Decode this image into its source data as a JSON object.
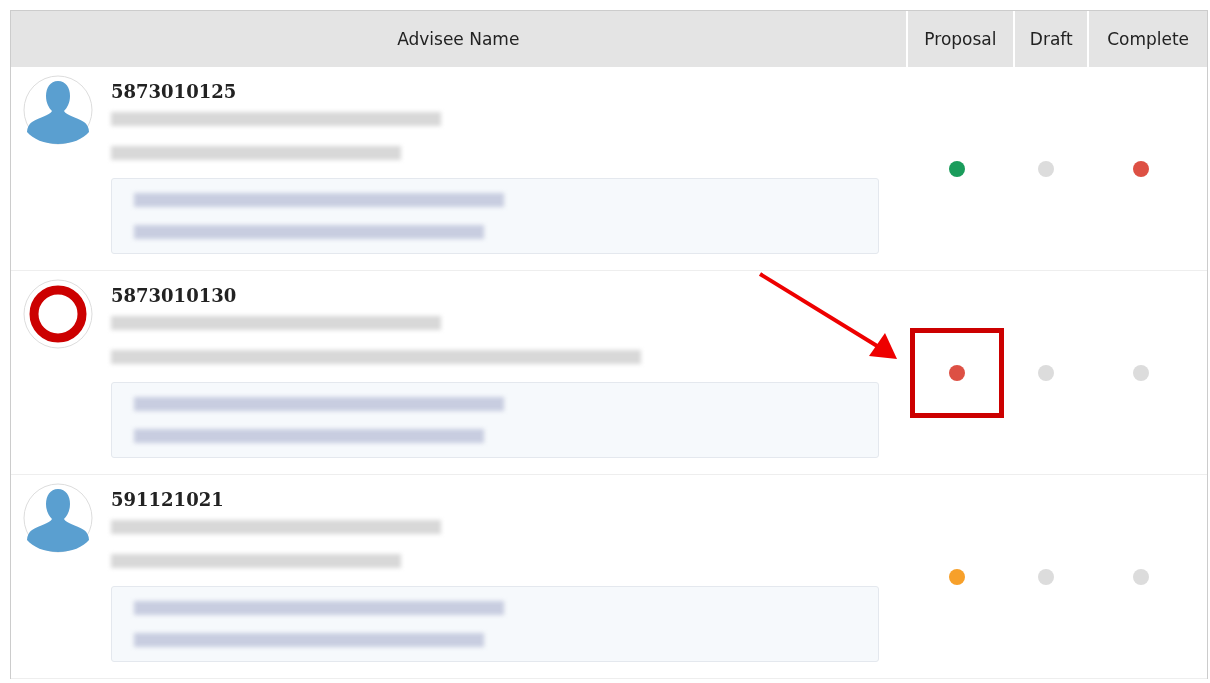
{
  "table": {
    "columns": [
      "Advisee Name",
      "Proposal",
      "Draft",
      "Complete"
    ],
    "rows": [
      {
        "student_id": "5873010125",
        "avatar": {
          "kind": "silhouette"
        },
        "statuses": [
          {
            "color": "#1a9c5b",
            "highlighted": false
          },
          {
            "color": "#dcdcdc",
            "highlighted": false
          },
          {
            "color": "#dd5044",
            "highlighted": false
          }
        ]
      },
      {
        "student_id": "5873010130",
        "avatar": {
          "kind": "ring"
        },
        "statuses": [
          {
            "color": "#dd5044",
            "highlighted": true
          },
          {
            "color": "#dcdcdc",
            "highlighted": false
          },
          {
            "color": "#dcdcdc",
            "highlighted": false
          }
        ]
      },
      {
        "student_id": "591121021",
        "avatar": {
          "kind": "silhouette"
        },
        "statuses": [
          {
            "color": "#f7a02a",
            "highlighted": false
          },
          {
            "color": "#dcdcdc",
            "highlighted": false
          },
          {
            "color": "#dcdcdc",
            "highlighted": false
          }
        ]
      }
    ]
  }
}
